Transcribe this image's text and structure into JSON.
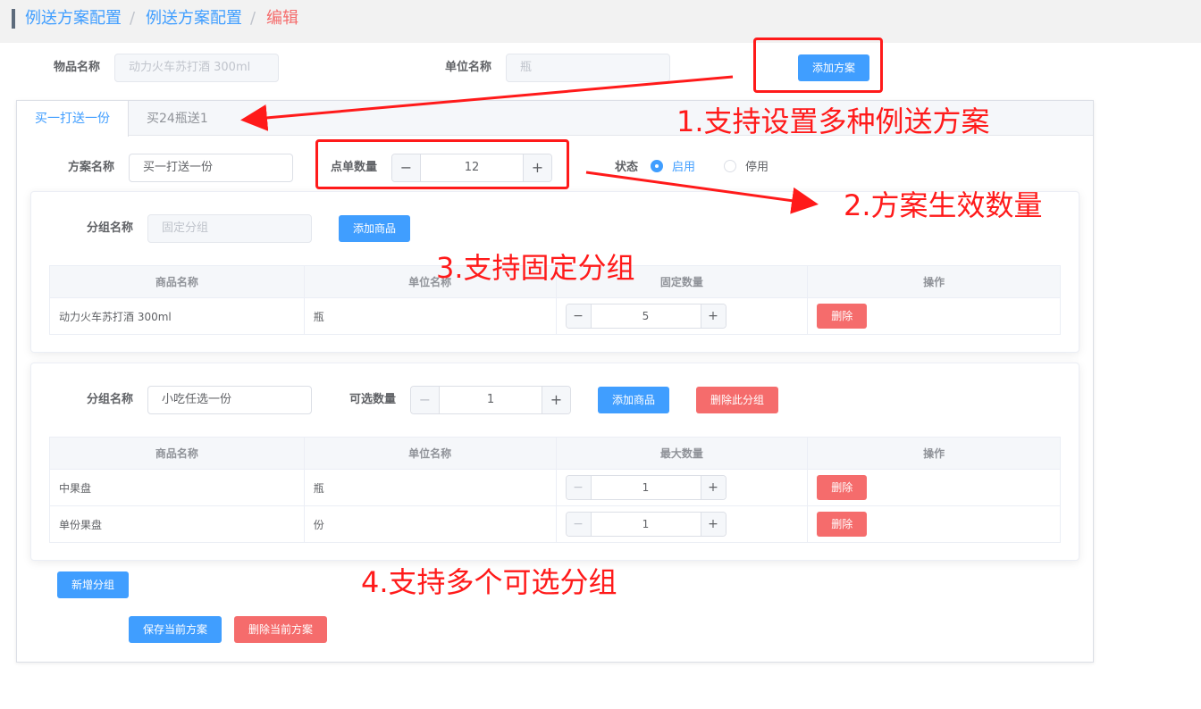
{
  "breadcrumb": {
    "items": [
      "例送方案配置",
      "例送方案配置"
    ],
    "separator": "/",
    "current": "编辑"
  },
  "header": {
    "item_name_label": "物品名称",
    "item_name_value": "动力火车苏打酒 300ml",
    "unit_name_label": "单位名称",
    "unit_name_value": "瓶",
    "add_plan_label": "添加方案"
  },
  "tabs": [
    {
      "label": "买一打送一份"
    },
    {
      "label": "买24瓶送1"
    }
  ],
  "plan": {
    "name_label": "方案名称",
    "name_value": "买一打送一份",
    "qty_label": "点单数量",
    "qty_value": "12",
    "status_label": "状态",
    "status_enabled": "启用",
    "status_disabled": "停用",
    "dec_symbol": "−",
    "inc_symbol": "+"
  },
  "fixed_group": {
    "name_label": "分组名称",
    "name_placeholder": "固定分组",
    "add_item_label": "添加商品",
    "columns": [
      "商品名称",
      "单位名称",
      "固定数量",
      "操作"
    ],
    "rows": [
      {
        "name": "动力火车苏打酒 300ml",
        "unit": "瓶",
        "qty": "5",
        "action": "删除"
      }
    ]
  },
  "optional_group": {
    "name_label": "分组名称",
    "name_value": "小吃任选一份",
    "qty_label": "可选数量",
    "qty_value": "1",
    "add_item_label": "添加商品",
    "delete_group_label": "删除此分组",
    "columns": [
      "商品名称",
      "单位名称",
      "最大数量",
      "操作"
    ],
    "rows": [
      {
        "name": "中果盘",
        "unit": "瓶",
        "qty": "1",
        "action": "删除"
      },
      {
        "name": "单份果盘",
        "unit": "份",
        "qty": "1",
        "action": "删除"
      }
    ]
  },
  "footer": {
    "add_group_label": "新增分组",
    "save_label": "保存当前方案",
    "delete_label": "删除当前方案"
  },
  "annotations": {
    "a1": "1.支持设置多种例送方案",
    "a2": "2.方案生效数量",
    "a3": "3.支持固定分组",
    "a4": "4.支持多个可选分组"
  },
  "colors": {
    "primary": "#409eff",
    "danger": "#f56c6c",
    "annotation": "#ff1a1a"
  }
}
